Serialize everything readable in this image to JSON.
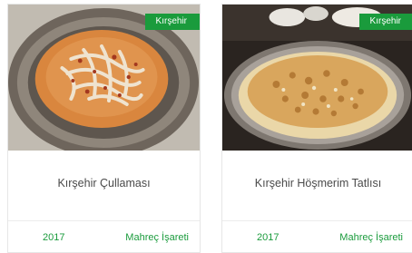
{
  "cards": [
    {
      "badge": "Kırşehir",
      "title": "Kırşehir Çullaması",
      "year": "2017",
      "type": "Mahreç İşareti"
    },
    {
      "badge": "Kırşehir",
      "title": "Kırşehir Höşmerim Tatlısı",
      "year": "2017",
      "type": "Mahreç İşareti"
    }
  ],
  "colors": {
    "accent": "#1a9b3c",
    "title_text": "#4a4a4a",
    "border": "#e6e6e6"
  }
}
